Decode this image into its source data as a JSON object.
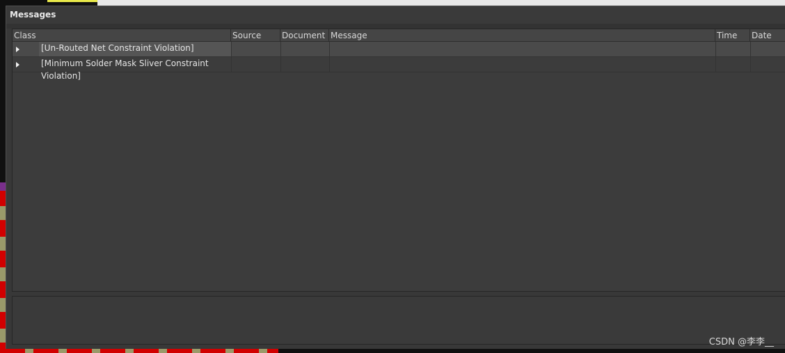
{
  "panel": {
    "title": "Messages"
  },
  "table": {
    "columns": [
      {
        "key": "class",
        "label": "Class"
      },
      {
        "key": "source",
        "label": "Source"
      },
      {
        "key": "document",
        "label": "Document"
      },
      {
        "key": "message",
        "label": "Message"
      },
      {
        "key": "time",
        "label": "Time"
      },
      {
        "key": "date",
        "label": "Date"
      }
    ],
    "rows": [
      {
        "class": "[Un-Routed Net Constraint Violation]",
        "selected": true
      },
      {
        "class": "[Minimum Solder Mask Sliver Constraint Violation]",
        "selected": false
      }
    ]
  },
  "watermark": "CSDN @李李__",
  "colors": {
    "panel_bg": "#383838",
    "header_bg": "#454545",
    "selected_row": "#4a4a4a",
    "text": "#e4e4e4"
  }
}
